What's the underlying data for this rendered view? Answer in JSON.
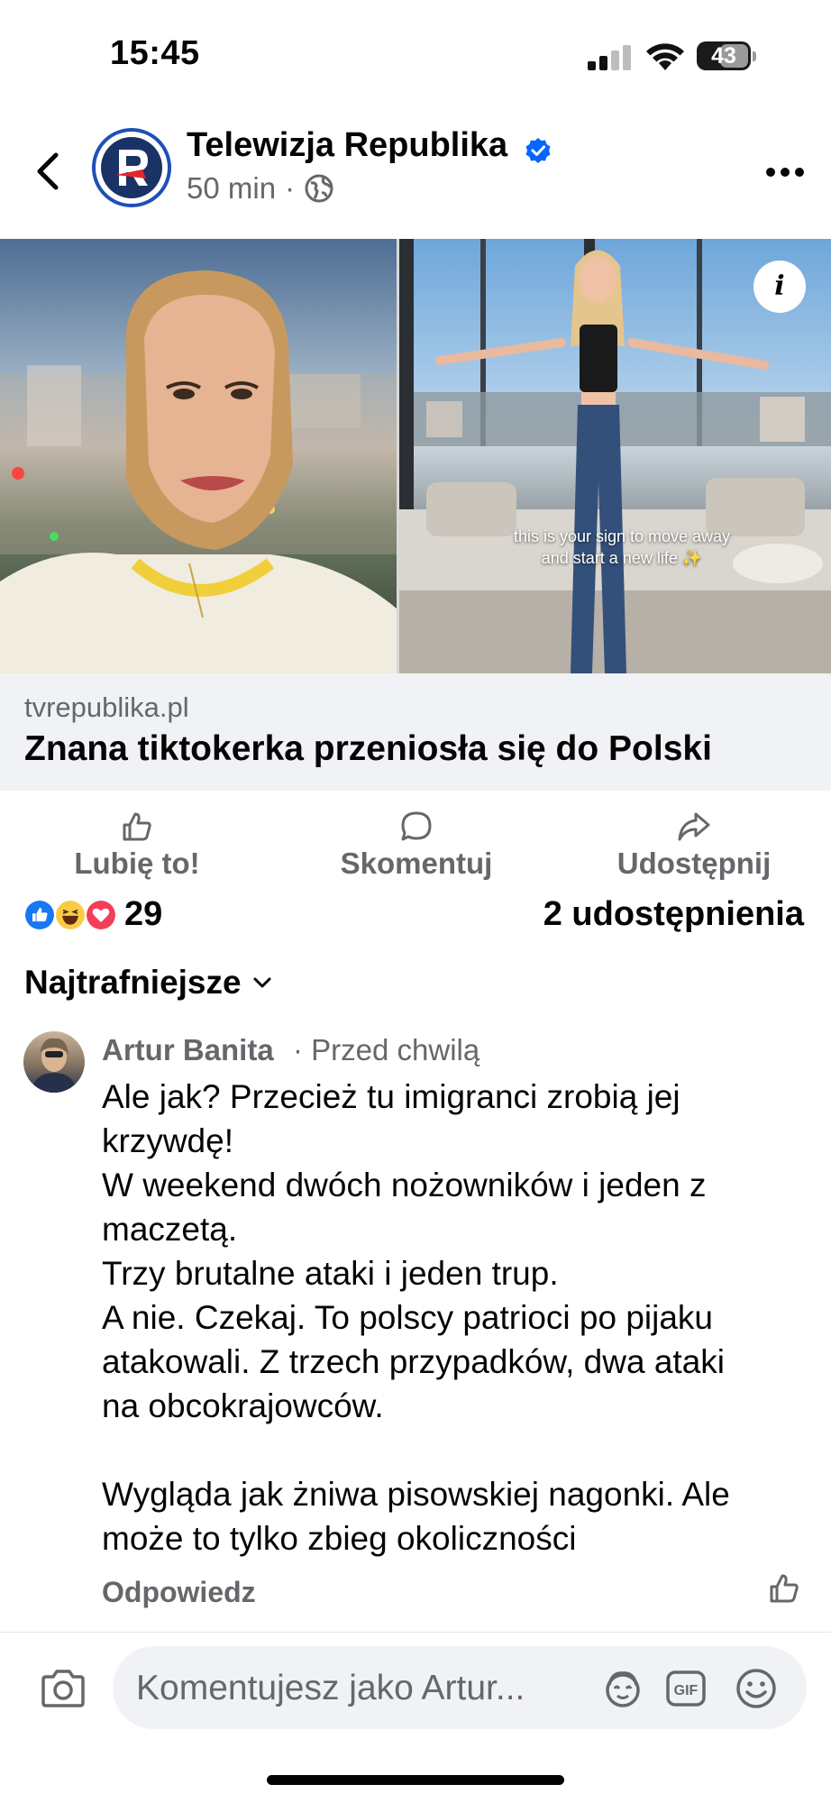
{
  "status_bar": {
    "time": "15:45",
    "battery": "43"
  },
  "post": {
    "page_name": "Telewizja Republika",
    "time": "50 min",
    "separator": "·",
    "audience_icon": "globe-icon",
    "verified_icon": "verified-badge-icon"
  },
  "media": {
    "overlay_caption_line1": "this is your sign to move away",
    "overlay_caption_line2": "and start a new life ✨",
    "info_label": "i"
  },
  "link_preview": {
    "domain": "tvrepublika.pl",
    "title": "Znana tiktokerka przeniosła się do Polski"
  },
  "actions": {
    "like_label": "Lubię to!",
    "comment_label": "Skomentuj",
    "share_label": "Udostępnij"
  },
  "reactions": {
    "count": "29",
    "shares": "2 udostępnienia",
    "types": [
      "like",
      "haha",
      "love"
    ]
  },
  "sort": {
    "label": "Najtrafniejsze"
  },
  "comment": {
    "author": "Artur Banita",
    "time": "· Przed chwilą",
    "lines": [
      "Ale jak? Przecież tu imigranci zrobią jej",
      "krzywdę!",
      "W weekend dwóch nożowników i jeden z",
      "maczetą.",
      "Trzy brutalne ataki i jeden trup.",
      "A nie. Czekaj. To polscy patrioci po pijaku",
      "atakowali. Z trzech przypadków, dwa ataki",
      "na obcokrajowców.",
      "",
      "Wygląda jak żniwa pisowskiej nagonki. Ale",
      "może to tylko zbieg okoliczności"
    ],
    "reply_label": "Odpowiedz"
  },
  "composer": {
    "placeholder": "Komentujesz jako Artur..."
  },
  "colors": {
    "accent": "#0866ff",
    "secondary_text": "#65676b",
    "link_card_bg": "#f0f2f5"
  }
}
